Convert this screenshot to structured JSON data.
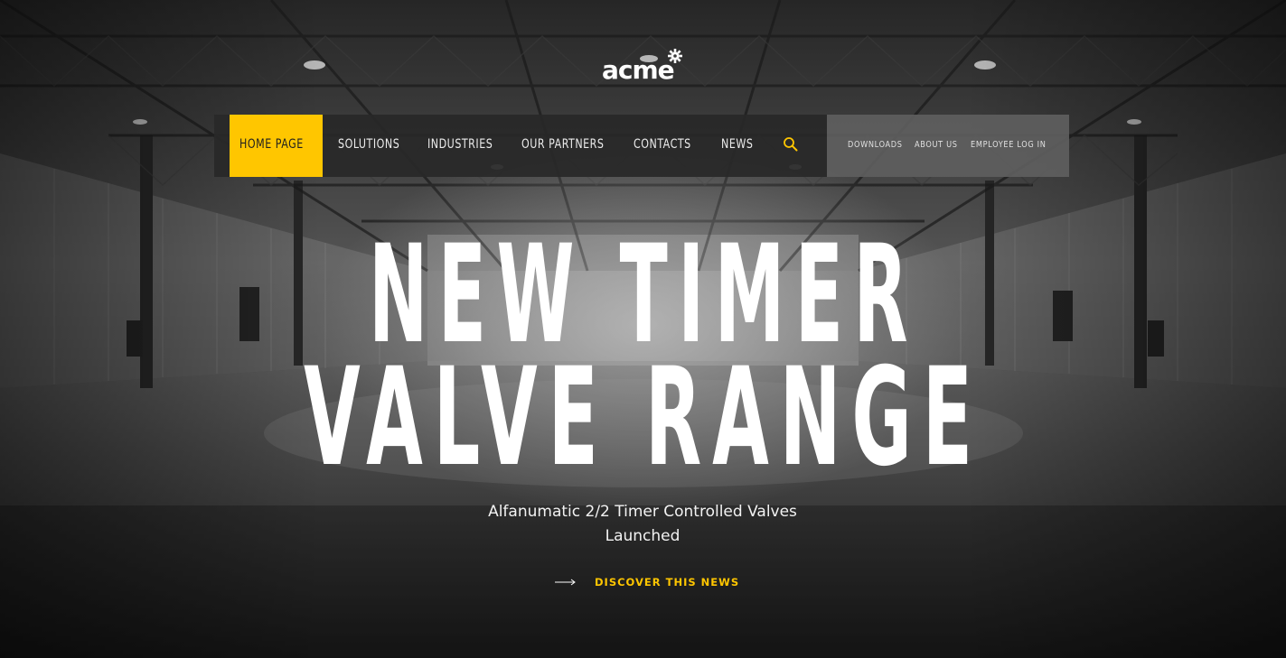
{
  "logo": {
    "text": "acme"
  },
  "main_nav": {
    "items": [
      {
        "label": "HOME PAGE",
        "active": true
      },
      {
        "label": "SOLUTIONS",
        "active": false
      },
      {
        "label": "INDUSTRIES",
        "active": false
      },
      {
        "label": "OUR PARTNERS",
        "active": false
      },
      {
        "label": "CONTACTS",
        "active": false
      },
      {
        "label": "NEWS",
        "active": false
      }
    ],
    "search_icon": "search-icon"
  },
  "secondary_nav": {
    "items": [
      {
        "label": "DOWNLOADS"
      },
      {
        "label": "ABOUT US"
      },
      {
        "label": "EMPLOYEE LOG IN"
      }
    ]
  },
  "hero": {
    "headline_line1": "NEW TIMER",
    "headline_line2": "VALVE RANGE",
    "subtitle": "Alfanumatic 2/2 Timer Controlled Valves Launched",
    "cta_label": "DISCOVER THIS NEWS",
    "cta_icon": "arrow-right-icon"
  },
  "colors": {
    "accent": "#ffc600",
    "nav_bg": "#282828",
    "secondary_nav_bg": "#5f5f5f",
    "text": "#ffffff"
  }
}
